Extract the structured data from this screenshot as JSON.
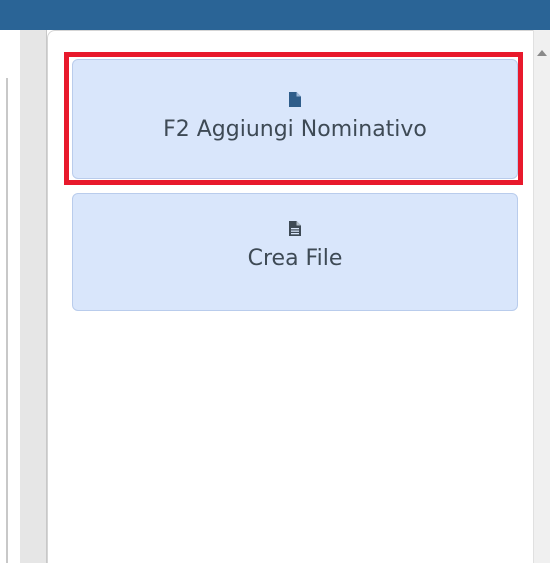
{
  "actions": [
    {
      "label": "F2 Aggiungi Nominativo",
      "icon": "file-icon"
    },
    {
      "label": "Crea File",
      "icon": "file-text-icon"
    }
  ],
  "colors": {
    "topbar": "#2a6496",
    "button_bg": "#d9e6fb",
    "button_text": "#3e4a55",
    "highlight": "#e8192c"
  }
}
